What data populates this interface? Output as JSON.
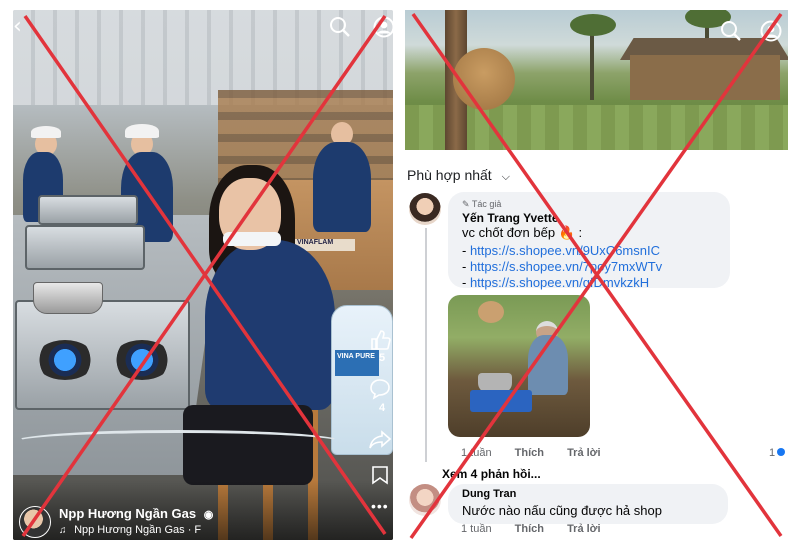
{
  "left_panel": {
    "box_label": "VINAFLAM",
    "water_label": "VINA PURE",
    "channel_name": "Npp Hương Ngần Gas",
    "verified_icon": "verified-badge-icon",
    "audio_name": "Npp Hương Ngần Gas · F",
    "music_icon": "♫",
    "side_counts": [
      "5",
      "4"
    ]
  },
  "right_panel": {
    "sort_label": "Phù hợp nhất",
    "comment_1": {
      "badge": "Tác giả",
      "author": "Yến Trang Yvette",
      "text": "vc chốt đơn bếp 🔥 :",
      "links": [
        "https://s.shopee.vn/9UxC6msnIC",
        "https://s.shopee.vn/7poy7mxWTv",
        "https://s.shopee.vn/qfDmvkzkH"
      ],
      "time": "1 tuần",
      "like_label": "Thích",
      "reply_label": "Trả lời",
      "reaction_count": "1"
    },
    "more_replies": "Xem 4 phản hồi...",
    "comment_2": {
      "author": "Dung Tran",
      "text": "Nước nào nấu cũng được hả shop",
      "time": "1 tuần",
      "like_label": "Thích",
      "reply_label": "Trả lời"
    }
  },
  "colors": {
    "x_mark": "#e2343c",
    "link": "#216fdb",
    "bubble": "#f0f2f5"
  }
}
